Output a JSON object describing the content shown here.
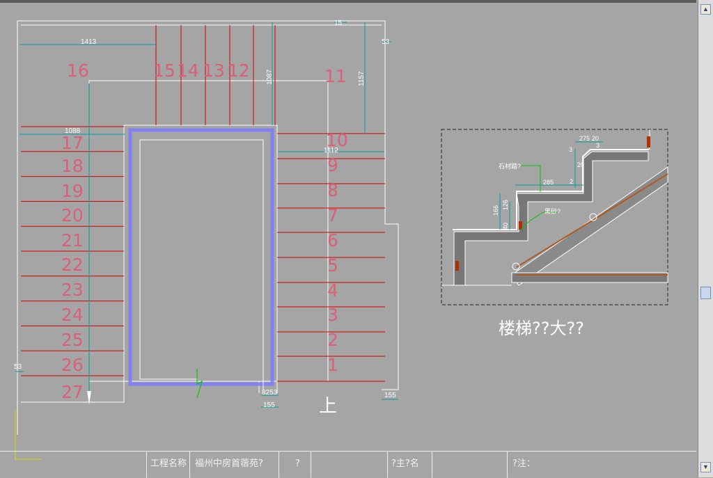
{
  "drawing": {
    "steps_left": [
      "16",
      "17",
      "18",
      "19",
      "20",
      "21",
      "22",
      "23",
      "24",
      "25",
      "26",
      "27"
    ],
    "steps_top": [
      "15",
      "14",
      "13",
      "12"
    ],
    "steps_right": [
      "11",
      "10",
      "9",
      "8",
      "7",
      "6",
      "5",
      "4",
      "3",
      "2",
      "1"
    ],
    "up_label": "上",
    "dims": {
      "d1413": "1413",
      "d1088": "1088",
      "d1087": "1087",
      "d1157": "1157",
      "d1112": "1112",
      "d15": "15",
      "d53_top": "53",
      "d53_left": "53",
      "d8253": "8253",
      "d155_a": "155",
      "d155_b": "155"
    }
  },
  "detail": {
    "caption": "楼梯??大??",
    "label_stone": "石材踏?",
    "label_black": "黑砂?",
    "dims": {
      "d275": "275",
      "d20": "20",
      "d3a": "3",
      "d3b": "3",
      "d2": "2",
      "d20b": "20",
      "d285": "285",
      "d166": "166",
      "d126": "126",
      "d40": "40"
    }
  },
  "titleblock": {
    "project_label": "工程名称",
    "project_value": "福州中房首蓿苑?",
    "field_q": "?",
    "designer": "?主?名",
    "note": "?注："
  },
  "scrollbar": {
    "up": "▲",
    "down": "▼"
  },
  "colors": {
    "background": "#a5a5a5",
    "lines": "#ffffff",
    "red": "#d40000",
    "teal": "#00a0a0",
    "blue": "#6a6aff",
    "green": "#00c800"
  }
}
